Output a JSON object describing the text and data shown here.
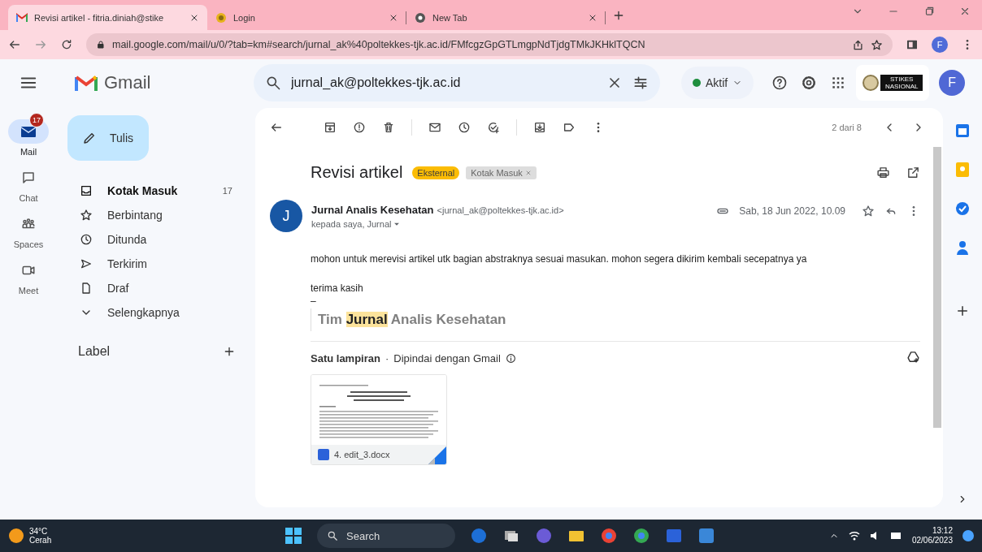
{
  "browser": {
    "tabs": [
      {
        "title": "Revisi artikel - fitria.diniah@stike",
        "kind": "gmail",
        "selected": true
      },
      {
        "title": "Login",
        "kind": "site",
        "selected": false
      },
      {
        "title": "New Tab",
        "kind": "chrome",
        "selected": false
      }
    ],
    "url": "mail.google.com/mail/u/0/?tab=km#search/jurnal_ak%40poltekkes-tjk.ac.id/FMfcgzGpGTLmgpNdTjdgTMkJKHklTQCN",
    "profile_initial": "F"
  },
  "gmail": {
    "logo": "Gmail",
    "search_value": "jurnal_ak@poltekkes-tjk.ac.id",
    "status": "Aktif",
    "org_logo": "STIKES NASIONAL",
    "account_initial": "F"
  },
  "rail": [
    {
      "label": "Mail",
      "kind": "mail",
      "badge": "17",
      "selected": true
    },
    {
      "label": "Chat",
      "kind": "chat",
      "selected": false
    },
    {
      "label": "Spaces",
      "kind": "spaces",
      "selected": false
    },
    {
      "label": "Meet",
      "kind": "meet",
      "selected": false
    }
  ],
  "compose": "Tulis",
  "folders": [
    {
      "label": "Kotak Masuk",
      "kind": "inbox",
      "count": "17",
      "unread": true
    },
    {
      "label": "Berbintang",
      "kind": "starred",
      "unread": false
    },
    {
      "label": "Ditunda",
      "kind": "snoozed",
      "unread": false
    },
    {
      "label": "Terkirim",
      "kind": "sent",
      "unread": false
    },
    {
      "label": "Draf",
      "kind": "drafts",
      "unread": false
    },
    {
      "label": "Selengkapnya",
      "kind": "more",
      "unread": false
    }
  ],
  "labels_heading": "Label",
  "message": {
    "pager": "2 dari 8",
    "subject": "Revisi artikel",
    "tags": [
      {
        "text": "Eksternal",
        "kind": "warning"
      },
      {
        "text": "Kotak Masuk",
        "kind": "label"
      }
    ],
    "sender_initial": "J",
    "sender_name": "Jurnal Analis Kesehatan",
    "sender_email": "<jurnal_ak@poltekkes-tjk.ac.id>",
    "recipients": "kepada saya, Jurnal",
    "date": "Sab, 18 Jun 2022, 10.09",
    "starred": false,
    "body": [
      "mohon untuk merevisi artikel utk bagian abstraknya sesuai masukan. mohon segera dikirim kembali secepatnya ya",
      "terima kasih"
    ],
    "signature_separator": "–",
    "signature": "Tim **Jurnal** Analis Kesehatan",
    "attachments_heading": "Satu lampiran",
    "heading_separator": "·",
    "scan_note": "Dipindai dengan Gmail",
    "attachments": [
      {
        "name": "4. edit_3.docx"
      }
    ]
  },
  "taskbar": {
    "temperature": "34°C",
    "condition": "Cerah",
    "search": "Search",
    "time": "13:12",
    "date": "02/06/2023"
  }
}
